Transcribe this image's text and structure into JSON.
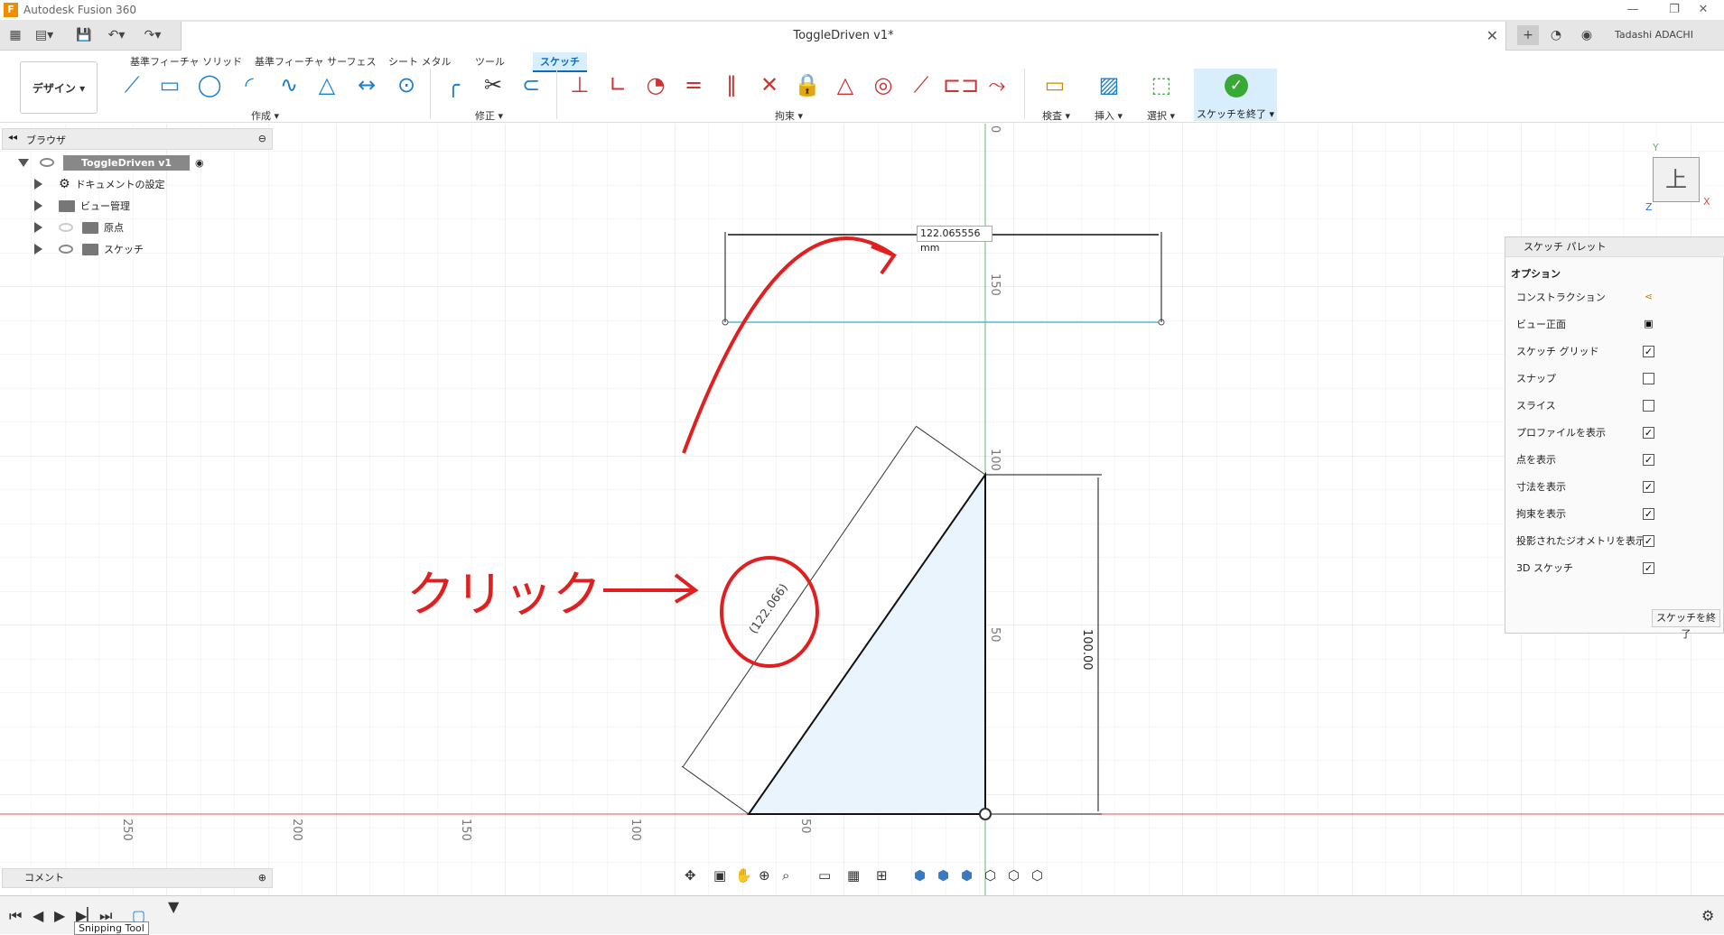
{
  "app": {
    "title": "Autodesk Fusion 360",
    "logo_letter": "F"
  },
  "document": {
    "title": "ToggleDriven v1*",
    "user": "Tadashi ADACHI"
  },
  "ribbon": {
    "tabs": [
      "基準フィーチャ ソリッド",
      "基準フィーチャ サーフェス",
      "シート メタル",
      "ツール",
      "スケッチ"
    ],
    "workspace": "デザイン ▾",
    "groups": {
      "create": "作成 ▾",
      "modify": "修正 ▾",
      "constrain": "拘束 ▾",
      "inspect": "検査 ▾",
      "insert": "挿入 ▾",
      "select": "選択 ▾",
      "finish": "スケッチを終了 ▾"
    }
  },
  "browser": {
    "title": "ブラウザ",
    "root": "ToggleDriven v1",
    "items": [
      "ドキュメントの設定",
      "ビュー管理",
      "原点",
      "スケッチ"
    ]
  },
  "palette": {
    "title": "スケッチ パレット",
    "section": "オプション",
    "rows": [
      {
        "label": "コンストラクション",
        "type": "icon",
        "icon": "construction-icon"
      },
      {
        "label": "ビュー正面",
        "type": "icon",
        "icon": "look-at-icon"
      },
      {
        "label": "スケッチ グリッド",
        "checked": true
      },
      {
        "label": "スナップ",
        "checked": false
      },
      {
        "label": "スライス",
        "checked": false
      },
      {
        "label": "プロファイルを表示",
        "checked": true
      },
      {
        "label": "点を表示",
        "checked": true
      },
      {
        "label": "寸法を表示",
        "checked": true
      },
      {
        "label": "拘束を表示",
        "checked": true
      },
      {
        "label": "投影されたジオメトリを表示",
        "checked": true
      },
      {
        "label": "3D スケッチ",
        "checked": true
      }
    ],
    "finish_button": "スケッチを終了"
  },
  "canvas": {
    "dimension_input": "122.065556 mm",
    "driven_dimension": "(122.066)",
    "vertical_dimension": "100.00",
    "axis_labels": [
      "0",
      "150",
      "100",
      "50",
      "250",
      "200",
      "150",
      "100",
      "50"
    ],
    "annotation_text": "クリック",
    "viewcube_face": "上",
    "axis_x": "X",
    "axis_y": "Y",
    "axis_z": "Z"
  },
  "comments": {
    "label": "コメント"
  },
  "taskbar": {
    "tooltip": "Snipping Tool"
  },
  "colors": {
    "accent": "#0a6cc2",
    "sketch_red": "#e02020",
    "green_axis": "#5fbf5f",
    "finish_green": "#39a935"
  }
}
